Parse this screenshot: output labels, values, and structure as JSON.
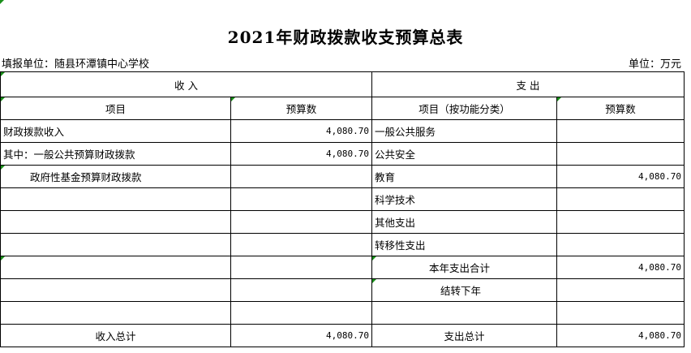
{
  "title": "2021年财政拨款收支预算总表",
  "fill_unit": "填报单位：随县环潭镇中心学校",
  "unit": "单位：万元",
  "headers": {
    "income": "收        入",
    "expense": "支              出",
    "item": "项目",
    "budget_amount": "预算数",
    "item_by_function": "项目（按功能分类）",
    "budget_amount2": "预算数"
  },
  "rows": [
    {
      "in_label": "财政拨款收入",
      "in_value": "4,080.70",
      "out_label": "一般公共服务",
      "out_value": ""
    },
    {
      "in_label": "其中：一般公共预算财政拨款",
      "in_value": "4,080.70",
      "out_label": "公共安全",
      "out_value": ""
    },
    {
      "in_label": "政府性基金预算财政拨款",
      "in_value": "",
      "out_label": "教育",
      "out_value": "4,080.70"
    },
    {
      "in_label": "",
      "in_value": "",
      "out_label": "科学技术",
      "out_value": ""
    },
    {
      "in_label": "",
      "in_value": "",
      "out_label": "其他支出",
      "out_value": ""
    },
    {
      "in_label": "",
      "in_value": "",
      "out_label": "转移性支出",
      "out_value": ""
    },
    {
      "in_label": "",
      "in_value": "",
      "out_label": "本年支出合计",
      "out_value": "4,080.70"
    },
    {
      "in_label": "",
      "in_value": "",
      "out_label": "结转下年",
      "out_value": ""
    },
    {
      "in_label": "",
      "in_value": "",
      "out_label": "",
      "out_value": ""
    }
  ],
  "totals": {
    "income_label": "收入总计",
    "income_value": "4,080.70",
    "expense_label": "支出总计",
    "expense_value": "4,080.70"
  },
  "colors": {
    "grid": "#000000",
    "cell_marker": "#1a8f1a"
  }
}
